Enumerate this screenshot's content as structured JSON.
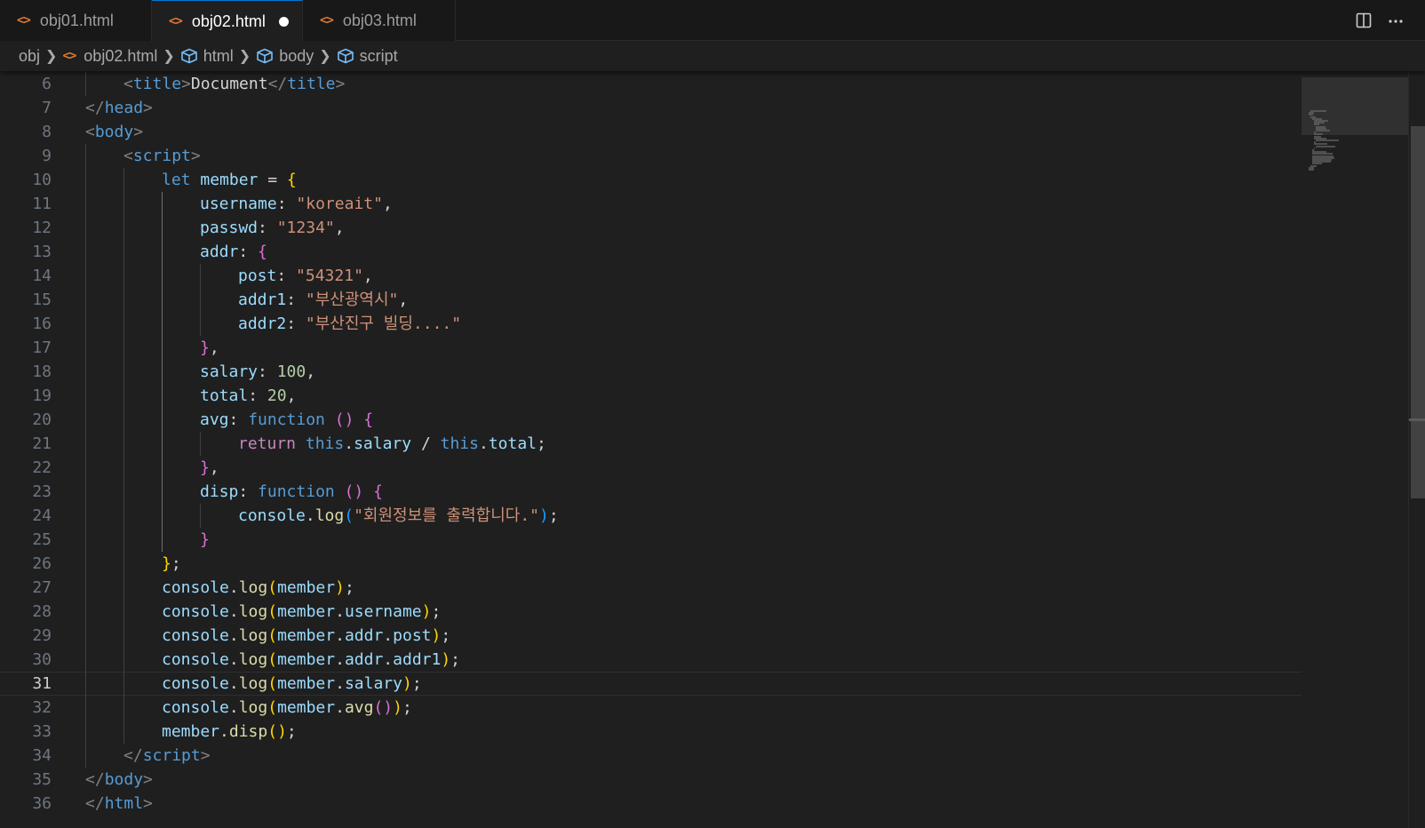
{
  "tabs": [
    {
      "label": "obj01.html",
      "active": false,
      "dirty": false
    },
    {
      "label": "obj02.html",
      "active": true,
      "dirty": true
    },
    {
      "label": "obj03.html",
      "active": false,
      "dirty": false
    }
  ],
  "tab_actions": [
    {
      "icon": "split-editor-icon"
    },
    {
      "icon": "more-actions-icon"
    }
  ],
  "breadcrumb": [
    {
      "label": "obj",
      "icon": "none"
    },
    {
      "label": "obj02.html",
      "icon": "html-file-icon"
    },
    {
      "label": "html",
      "icon": "symbol-structure-icon"
    },
    {
      "label": "body",
      "icon": "symbol-structure-icon"
    },
    {
      "label": "script",
      "icon": "symbol-structure-icon"
    }
  ],
  "editor": {
    "current_line": 31,
    "lines": [
      {
        "n": "6",
        "indent": 1,
        "tokens": [
          [
            "&lt;",
            "punc"
          ],
          [
            "title",
            "tag"
          ],
          [
            "&gt;",
            "punc"
          ],
          [
            "Document",
            "text"
          ],
          [
            "&lt;/",
            "punc"
          ],
          [
            "title",
            "tag"
          ],
          [
            "&gt;",
            "punc"
          ]
        ]
      },
      {
        "n": "7",
        "indent": 0,
        "tokens": [
          [
            "&lt;/",
            "punc"
          ],
          [
            "head",
            "tag"
          ],
          [
            "&gt;",
            "punc"
          ]
        ]
      },
      {
        "n": "8",
        "indent": 0,
        "tokens": [
          [
            "&lt;",
            "punc"
          ],
          [
            "body",
            "tag"
          ],
          [
            "&gt;",
            "punc"
          ]
        ]
      },
      {
        "n": "9",
        "indent": 1,
        "tokens": [
          [
            "&lt;",
            "punc"
          ],
          [
            "script",
            "tag"
          ],
          [
            "&gt;",
            "punc"
          ]
        ]
      },
      {
        "n": "10",
        "indent": 2,
        "tokens": [
          [
            "let",
            "kw"
          ],
          [
            " member",
            "var"
          ],
          [
            " = ",
            "op"
          ],
          [
            "{",
            "b1"
          ]
        ]
      },
      {
        "n": "11",
        "indent": 3,
        "tokens": [
          [
            "username",
            "var"
          ],
          [
            ": ",
            "op"
          ],
          [
            "\"koreait\"",
            "str"
          ],
          [
            ",",
            "op"
          ]
        ]
      },
      {
        "n": "12",
        "indent": 3,
        "tokens": [
          [
            "passwd",
            "var"
          ],
          [
            ": ",
            "op"
          ],
          [
            "\"1234\"",
            "str"
          ],
          [
            ",",
            "op"
          ]
        ]
      },
      {
        "n": "13",
        "indent": 3,
        "tokens": [
          [
            "addr",
            "var"
          ],
          [
            ": ",
            "op"
          ],
          [
            "{",
            "b2"
          ]
        ]
      },
      {
        "n": "14",
        "indent": 4,
        "tokens": [
          [
            "post",
            "var"
          ],
          [
            ": ",
            "op"
          ],
          [
            "\"54321\"",
            "str"
          ],
          [
            ",",
            "op"
          ]
        ]
      },
      {
        "n": "15",
        "indent": 4,
        "tokens": [
          [
            "addr1",
            "var"
          ],
          [
            ": ",
            "op"
          ],
          [
            "\"부산광역시\"",
            "str"
          ],
          [
            ",",
            "op"
          ]
        ]
      },
      {
        "n": "16",
        "indent": 4,
        "tokens": [
          [
            "addr2",
            "var"
          ],
          [
            ": ",
            "op"
          ],
          [
            "\"부산진구 빌딩....\"",
            "str"
          ]
        ]
      },
      {
        "n": "17",
        "indent": 3,
        "tokens": [
          [
            "}",
            "b2"
          ],
          [
            ",",
            "op"
          ]
        ]
      },
      {
        "n": "18",
        "indent": 3,
        "tokens": [
          [
            "salary",
            "var"
          ],
          [
            ": ",
            "op"
          ],
          [
            "100",
            "num"
          ],
          [
            ",",
            "op"
          ]
        ]
      },
      {
        "n": "19",
        "indent": 3,
        "tokens": [
          [
            "total",
            "var"
          ],
          [
            ": ",
            "op"
          ],
          [
            "20",
            "num"
          ],
          [
            ",",
            "op"
          ]
        ]
      },
      {
        "n": "20",
        "indent": 3,
        "tokens": [
          [
            "avg",
            "var"
          ],
          [
            ": ",
            "op"
          ],
          [
            "function",
            "kw"
          ],
          [
            " ",
            "op"
          ],
          [
            "()",
            "b2"
          ],
          [
            " ",
            "op"
          ],
          [
            "{",
            "b2"
          ]
        ]
      },
      {
        "n": "21",
        "indent": 4,
        "tokens": [
          [
            "return",
            "ctrl"
          ],
          [
            " ",
            "op"
          ],
          [
            "this",
            "kw"
          ],
          [
            ".",
            "op"
          ],
          [
            "salary",
            "var"
          ],
          [
            " / ",
            "op"
          ],
          [
            "this",
            "kw"
          ],
          [
            ".",
            "op"
          ],
          [
            "total",
            "var"
          ],
          [
            ";",
            "op"
          ]
        ]
      },
      {
        "n": "22",
        "indent": 3,
        "tokens": [
          [
            "}",
            "b2"
          ],
          [
            ",",
            "op"
          ]
        ]
      },
      {
        "n": "23",
        "indent": 3,
        "tokens": [
          [
            "disp",
            "var"
          ],
          [
            ": ",
            "op"
          ],
          [
            "function",
            "kw"
          ],
          [
            " ",
            "op"
          ],
          [
            "()",
            "b2"
          ],
          [
            " ",
            "op"
          ],
          [
            "{",
            "b2"
          ]
        ]
      },
      {
        "n": "24",
        "indent": 4,
        "tokens": [
          [
            "console",
            "var"
          ],
          [
            ".",
            "op"
          ],
          [
            "log",
            "fn"
          ],
          [
            "(",
            "b3"
          ],
          [
            "\"회원정보를 출력합니다.\"",
            "str"
          ],
          [
            ")",
            "b3"
          ],
          [
            ";",
            "op"
          ]
        ]
      },
      {
        "n": "25",
        "indent": 3,
        "tokens": [
          [
            "}",
            "b2"
          ]
        ]
      },
      {
        "n": "26",
        "indent": 2,
        "tokens": [
          [
            "}",
            "b1"
          ],
          [
            ";",
            "op"
          ]
        ]
      },
      {
        "n": "27",
        "indent": 2,
        "tokens": [
          [
            "console",
            "var"
          ],
          [
            ".",
            "op"
          ],
          [
            "log",
            "fn"
          ],
          [
            "(",
            "b1"
          ],
          [
            "member",
            "var"
          ],
          [
            ")",
            "b1"
          ],
          [
            ";",
            "op"
          ]
        ]
      },
      {
        "n": "28",
        "indent": 2,
        "tokens": [
          [
            "console",
            "var"
          ],
          [
            ".",
            "op"
          ],
          [
            "log",
            "fn"
          ],
          [
            "(",
            "b1"
          ],
          [
            "member",
            "var"
          ],
          [
            ".",
            "op"
          ],
          [
            "username",
            "var"
          ],
          [
            ")",
            "b1"
          ],
          [
            ";",
            "op"
          ]
        ]
      },
      {
        "n": "29",
        "indent": 2,
        "tokens": [
          [
            "console",
            "var"
          ],
          [
            ".",
            "op"
          ],
          [
            "log",
            "fn"
          ],
          [
            "(",
            "b1"
          ],
          [
            "member",
            "var"
          ],
          [
            ".",
            "op"
          ],
          [
            "addr",
            "var"
          ],
          [
            ".",
            "op"
          ],
          [
            "post",
            "var"
          ],
          [
            ")",
            "b1"
          ],
          [
            ";",
            "op"
          ]
        ]
      },
      {
        "n": "30",
        "indent": 2,
        "tokens": [
          [
            "console",
            "var"
          ],
          [
            ".",
            "op"
          ],
          [
            "log",
            "fn"
          ],
          [
            "(",
            "b1"
          ],
          [
            "member",
            "var"
          ],
          [
            ".",
            "op"
          ],
          [
            "addr",
            "var"
          ],
          [
            ".",
            "op"
          ],
          [
            "addr1",
            "var"
          ],
          [
            ")",
            "b1"
          ],
          [
            ";",
            "op"
          ]
        ]
      },
      {
        "n": "31",
        "indent": 2,
        "tokens": [
          [
            "console",
            "var"
          ],
          [
            ".",
            "op"
          ],
          [
            "log",
            "fn"
          ],
          [
            "(",
            "b1"
          ],
          [
            "member",
            "var"
          ],
          [
            ".",
            "op"
          ],
          [
            "salary",
            "var"
          ],
          [
            ")",
            "b1"
          ],
          [
            ";",
            "op"
          ]
        ]
      },
      {
        "n": "32",
        "indent": 2,
        "tokens": [
          [
            "console",
            "var"
          ],
          [
            ".",
            "op"
          ],
          [
            "log",
            "fn"
          ],
          [
            "(",
            "b1"
          ],
          [
            "member",
            "var"
          ],
          [
            ".",
            "op"
          ],
          [
            "avg",
            "fn"
          ],
          [
            "()",
            "b2"
          ],
          [
            ")",
            "b1"
          ],
          [
            ";",
            "op"
          ]
        ]
      },
      {
        "n": "33",
        "indent": 2,
        "tokens": [
          [
            "member",
            "var"
          ],
          [
            ".",
            "op"
          ],
          [
            "disp",
            "fn"
          ],
          [
            "()",
            "b1"
          ],
          [
            ";",
            "op"
          ]
        ]
      },
      {
        "n": "34",
        "indent": 1,
        "tokens": [
          [
            "&lt;/",
            "punc"
          ],
          [
            "script",
            "tag"
          ],
          [
            "&gt;",
            "punc"
          ]
        ]
      },
      {
        "n": "35",
        "indent": 0,
        "tokens": [
          [
            "&lt;/",
            "punc"
          ],
          [
            "body",
            "tag"
          ],
          [
            "&gt;",
            "punc"
          ]
        ]
      },
      {
        "n": "36",
        "indent": 0,
        "tokens": [
          [
            "&lt;/",
            "punc"
          ],
          [
            "html",
            "tag"
          ],
          [
            "&gt;",
            "punc"
          ]
        ]
      }
    ]
  }
}
